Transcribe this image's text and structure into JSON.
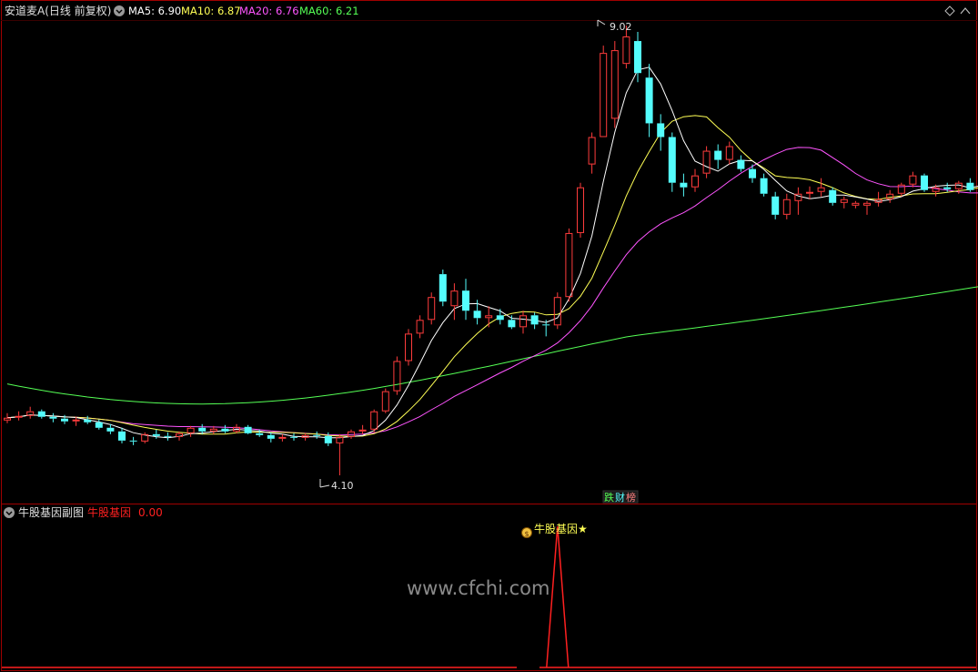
{
  "main_panel": {
    "stock_label": "安道麦A(日线 前复权)",
    "ma_items": [
      {
        "label": "MA5: 6.90",
        "color": "#ffffff"
      },
      {
        "label": "MA10: 6.87",
        "color": "#ffff55"
      },
      {
        "label": "MA20: 6.76",
        "color": "#ff55ff"
      },
      {
        "label": "MA60: 6.21",
        "color": "#55ff55"
      }
    ],
    "high_label": "9.02",
    "low_label": "4.10",
    "badge_left": "跌",
    "badge_mid": "财",
    "badge_right": "榜"
  },
  "sub_panel": {
    "title": "牛股基因副图",
    "indicator_label": "牛股基因",
    "indicator_value": "0.00",
    "signal_label": "牛股基因★",
    "watermark": "www.cfchi.com"
  },
  "colors": {
    "up": "#ff3c3c",
    "down": "#54fcfc",
    "ma5": "#ffffff",
    "ma10": "#ffff55",
    "ma20": "#ff55ff",
    "ma60": "#55ff55",
    "signal": "#ff2020",
    "frame": "#a00000"
  },
  "chart_data": {
    "type": "candlestick",
    "price_ticks_visible": false,
    "candles": [
      [
        4.7,
        4.78,
        4.67,
        4.73
      ],
      [
        4.73,
        4.8,
        4.7,
        4.75
      ],
      [
        4.75,
        4.85,
        4.72,
        4.8
      ],
      [
        4.8,
        4.82,
        4.72,
        4.74
      ],
      [
        4.74,
        4.78,
        4.68,
        4.72
      ],
      [
        4.72,
        4.76,
        4.66,
        4.69
      ],
      [
        4.69,
        4.74,
        4.64,
        4.71
      ],
      [
        4.71,
        4.75,
        4.66,
        4.68
      ],
      [
        4.68,
        4.71,
        4.6,
        4.62
      ],
      [
        4.62,
        4.66,
        4.55,
        4.58
      ],
      [
        4.58,
        4.62,
        4.45,
        4.48
      ],
      [
        4.48,
        4.52,
        4.43,
        4.47
      ],
      [
        4.47,
        4.57,
        4.45,
        4.55
      ],
      [
        4.55,
        4.6,
        4.5,
        4.53
      ],
      [
        4.53,
        4.57,
        4.48,
        4.52
      ],
      [
        4.52,
        4.58,
        4.48,
        4.56
      ],
      [
        4.56,
        4.64,
        4.52,
        4.62
      ],
      [
        4.62,
        4.66,
        4.55,
        4.58
      ],
      [
        4.58,
        4.64,
        4.55,
        4.61
      ],
      [
        4.61,
        4.65,
        4.56,
        4.58
      ],
      [
        4.58,
        4.66,
        4.56,
        4.63
      ],
      [
        4.63,
        4.65,
        4.55,
        4.56
      ],
      [
        4.56,
        4.6,
        4.52,
        4.54
      ],
      [
        4.54,
        4.57,
        4.46,
        4.5
      ],
      [
        4.5,
        4.55,
        4.47,
        4.52
      ],
      [
        4.52,
        4.56,
        4.48,
        4.51
      ],
      [
        4.51,
        4.56,
        4.48,
        4.54
      ],
      [
        4.54,
        4.58,
        4.5,
        4.53
      ],
      [
        4.53,
        4.57,
        4.42,
        4.45
      ],
      [
        4.45,
        4.55,
        4.1,
        4.52
      ],
      [
        4.52,
        4.6,
        4.5,
        4.58
      ],
      [
        4.58,
        4.65,
        4.55,
        4.6
      ],
      [
        4.6,
        4.82,
        4.57,
        4.8
      ],
      [
        4.8,
        5.05,
        4.78,
        5.02
      ],
      [
        5.02,
        5.4,
        4.98,
        5.35
      ],
      [
        5.35,
        5.7,
        5.3,
        5.65
      ],
      [
        5.65,
        5.85,
        5.6,
        5.8
      ],
      [
        5.8,
        6.1,
        5.75,
        6.05
      ],
      [
        6.3,
        6.35,
        5.95,
        6.0
      ],
      [
        5.95,
        6.2,
        5.8,
        6.12
      ],
      [
        6.12,
        6.25,
        5.8,
        5.9
      ],
      [
        5.9,
        6.02,
        5.75,
        5.82
      ],
      [
        5.82,
        5.95,
        5.72,
        5.85
      ],
      [
        5.85,
        5.92,
        5.75,
        5.8
      ],
      [
        5.8,
        5.85,
        5.7,
        5.72
      ],
      [
        5.72,
        5.9,
        5.65,
        5.85
      ],
      [
        5.85,
        5.88,
        5.7,
        5.75
      ],
      [
        5.75,
        5.8,
        5.62,
        5.74
      ],
      [
        5.74,
        6.1,
        5.7,
        6.05
      ],
      [
        6.05,
        6.8,
        6.0,
        6.75
      ],
      [
        6.75,
        7.3,
        6.7,
        7.25
      ],
      [
        7.5,
        7.85,
        7.4,
        7.8
      ],
      [
        7.8,
        8.8,
        7.8,
        8.72
      ],
      [
        8.0,
        8.85,
        7.9,
        8.75
      ],
      [
        8.6,
        9.02,
        8.55,
        8.9
      ],
      [
        8.85,
        8.95,
        8.4,
        8.5
      ],
      [
        8.45,
        8.6,
        7.8,
        7.95
      ],
      [
        7.95,
        8.05,
        7.65,
        7.8
      ],
      [
        7.8,
        7.85,
        7.2,
        7.3
      ],
      [
        7.3,
        7.4,
        7.15,
        7.25
      ],
      [
        7.25,
        7.45,
        7.2,
        7.38
      ],
      [
        7.4,
        7.7,
        7.35,
        7.65
      ],
      [
        7.65,
        7.72,
        7.45,
        7.55
      ],
      [
        7.55,
        7.75,
        7.5,
        7.7
      ],
      [
        7.55,
        7.6,
        7.42,
        7.45
      ],
      [
        7.45,
        7.5,
        7.3,
        7.35
      ],
      [
        7.35,
        7.4,
        7.15,
        7.18
      ],
      [
        7.15,
        7.2,
        6.9,
        6.95
      ],
      [
        6.95,
        7.18,
        6.9,
        7.12
      ],
      [
        7.1,
        7.25,
        6.95,
        7.18
      ],
      [
        7.18,
        7.26,
        7.12,
        7.2
      ],
      [
        7.2,
        7.35,
        7.15,
        7.25
      ],
      [
        7.22,
        7.25,
        7.05,
        7.08
      ],
      [
        7.08,
        7.15,
        7.02,
        7.12
      ],
      [
        7.05,
        7.1,
        7.02,
        7.08
      ],
      [
        7.05,
        7.1,
        6.95,
        7.08
      ],
      [
        7.08,
        7.2,
        7.04,
        7.12
      ],
      [
        7.12,
        7.22,
        7.08,
        7.18
      ],
      [
        7.18,
        7.3,
        7.15,
        7.28
      ],
      [
        7.28,
        7.42,
        7.25,
        7.38
      ],
      [
        7.38,
        7.4,
        7.2,
        7.22
      ],
      [
        7.2,
        7.28,
        7.15,
        7.25
      ],
      [
        7.25,
        7.3,
        7.2,
        7.23
      ],
      [
        7.23,
        7.32,
        7.18,
        7.3
      ],
      [
        7.3,
        7.35,
        7.2,
        7.22
      ],
      [
        7.22,
        7.42,
        7.18,
        7.35
      ],
      [
        7.35,
        7.38,
        7.22,
        7.3
      ],
      [
        7.3,
        7.35,
        7.25,
        7.33
      ]
    ],
    "ma20_end": 6.76,
    "ma60_end": 6.21,
    "signal_index": 48,
    "indicator": {
      "baseline": 0,
      "peak": 1
    }
  }
}
